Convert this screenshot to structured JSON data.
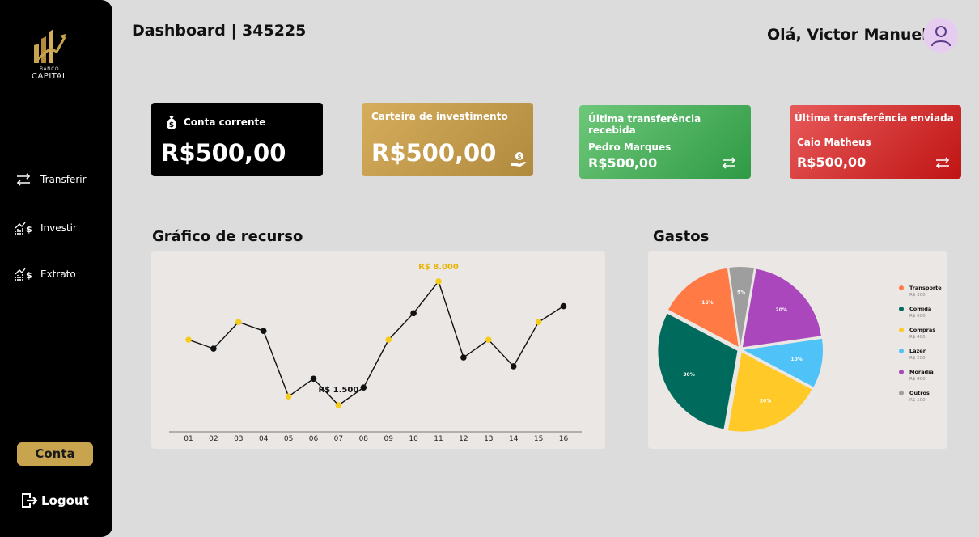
{
  "sidebar": {
    "logo": {
      "line1": "BANCO",
      "line2": "CAPITAL",
      "icon": "chart-arrow-logo"
    },
    "nav": [
      {
        "label": "Transferir",
        "icon": "transfer-arrows-icon"
      },
      {
        "label": "Investir",
        "icon": "invest-chart-icon"
      },
      {
        "label": "Extrato",
        "icon": "statement-chart-icon"
      }
    ],
    "account_button": "Conta",
    "logout_label": "Logout"
  },
  "header": {
    "title": "Dashboard | 345225",
    "greeting": "Olá, Victor Manuel",
    "avatar_icon": "user-icon"
  },
  "cards": {
    "checking": {
      "label": "Conta corrente",
      "amount": "R$500,00",
      "icon": "money-bag-icon"
    },
    "investment": {
      "label": "Carteira de investimento",
      "amount": "R$500,00",
      "icon": "hand-coin-icon"
    },
    "received": {
      "label": "Última transferência recebida",
      "name": "Pedro Marques",
      "amount": "R$500,00",
      "icon": "transfer-arrows-icon"
    },
    "sent": {
      "label": "Última transferência enviada",
      "name": "Caio Matheus",
      "amount": "R$500,00",
      "icon": "transfer-arrows-icon"
    }
  },
  "colors": {
    "gold": "#c9a44f",
    "green": "#3aa552",
    "red": "#d42020",
    "marker_yellow": "#f5cc1a",
    "marker_black": "#111111"
  },
  "chart_data": [
    {
      "type": "line",
      "title": "Gráfico de recurso",
      "categories": [
        "01",
        "02",
        "03",
        "04",
        "05",
        "06",
        "07",
        "08",
        "09",
        "10",
        "11",
        "12",
        "13",
        "14",
        "15",
        "16"
      ],
      "values": [
        4700,
        4200,
        5700,
        5200,
        1500,
        2500,
        1000,
        2000,
        4700,
        6200,
        8000,
        3700,
        4700,
        3200,
        5700,
        6600
      ],
      "marker_colors": [
        "yellow",
        "black",
        "yellow",
        "black",
        "yellow",
        "black",
        "yellow",
        "black",
        "yellow",
        "black",
        "yellow",
        "black",
        "yellow",
        "black",
        "yellow",
        "black"
      ],
      "annotations": [
        {
          "index": 10,
          "text": "R$ 8.000",
          "color": "#e8b400"
        },
        {
          "index": 6,
          "text": "R$ 1.500",
          "color": "#111111"
        }
      ],
      "ylim": [
        0,
        9000
      ],
      "grid": false
    },
    {
      "type": "pie",
      "title": "Gastos",
      "slices": [
        {
          "label": "Transporte",
          "sub": "R$ 300",
          "value": 15,
          "pct": "15%",
          "color": "#ff7a45"
        },
        {
          "label": "Comida",
          "sub": "R$ 600",
          "value": 30,
          "pct": "30%",
          "color": "#006b5c"
        },
        {
          "label": "Compras",
          "sub": "R$ 400",
          "value": 20,
          "pct": "20%",
          "color": "#ffca28"
        },
        {
          "label": "Lazer",
          "sub": "R$ 200",
          "value": 10,
          "pct": "10%",
          "color": "#4fc3f7"
        },
        {
          "label": "Moradia",
          "sub": "R$ 400",
          "value": 20,
          "pct": "20%",
          "color": "#ab47bc"
        },
        {
          "label": "Outros",
          "sub": "R$ 100",
          "value": 5,
          "pct": "5%",
          "color": "#9e9e9e"
        }
      ],
      "legend": "right"
    }
  ]
}
